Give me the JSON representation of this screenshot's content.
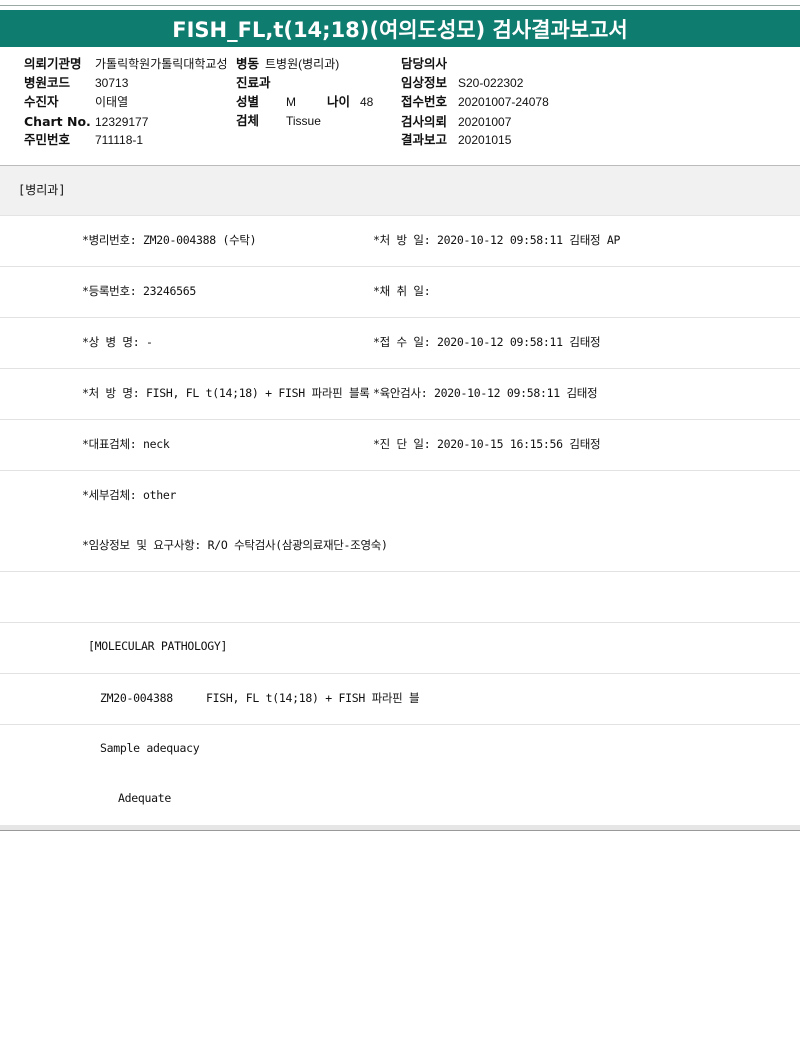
{
  "title": "FISH_FL,t(14;18)(여의도성모) 검사결과보고서",
  "header": {
    "institution_label": "의뢰기관명",
    "institution_value": "가톨릭학원가톨릭대학교성",
    "ward_label": "병동",
    "ward_value": "트병원(병리과)",
    "doctor_label": "담당의사",
    "doctor_value": "",
    "hospital_code_label": "병원코드",
    "hospital_code_value": "30713",
    "dept_label": "진료과",
    "dept_value": "",
    "clinical_info_label": "임상정보",
    "clinical_info_value": "S20-022302",
    "patient_label": "수진자",
    "patient_value": "이태열",
    "sex_label": "성별",
    "sex_value": "M",
    "age_label": "나이",
    "age_value": "48",
    "receipt_no_label": "접수번호",
    "receipt_no_value": "20201007-24078",
    "chart_label": "Chart No.",
    "chart_value": "12329177",
    "specimen_label": "검체",
    "specimen_value": "Tissue",
    "request_label": "검사의뢰",
    "request_value": "20201007",
    "id_label": "주민번호",
    "id_value": "711118-1",
    "report_label": "결과보고",
    "report_value": "20201015"
  },
  "section": {
    "label": "[병리과]"
  },
  "rows": [
    {
      "left": "*병리번호: ZM20-004388 (수탁)",
      "right": "*처 방 일: 2020-10-12 09:58:11  김태정 AP"
    },
    {
      "left": "*등록번호: 23246565",
      "right": "*채 취 일:"
    },
    {
      "left": "*상 병 명: -",
      "right": "*접 수 일: 2020-10-12 09:58:11  김태정"
    },
    {
      "left": "*처 방 명: FISH, FL t(14;18) + FISH 파라핀 블록",
      "right": "*육안검사: 2020-10-12 09:58:11  김태정"
    },
    {
      "left": "*대표검체: neck",
      "right": "*진 단 일: 2020-10-15 16:15:56  김태정"
    },
    {
      "left": "*세부검체: other",
      "right": ""
    },
    {
      "left": "*임상정보 및 요구사항: R/O 수탁검사(삼광의료재단-조영숙)",
      "right": ""
    },
    {
      "left": "",
      "right": ""
    },
    {
      "left": "[MOLECULAR PATHOLOGY]",
      "right": ""
    },
    {
      "left": "ZM20-004388     FISH, FL t(14;18) + FISH 파라핀 블",
      "right": ""
    },
    {
      "left": "Sample adequacy",
      "right": ""
    },
    {
      "left": "Adequate",
      "right": ""
    }
  ]
}
